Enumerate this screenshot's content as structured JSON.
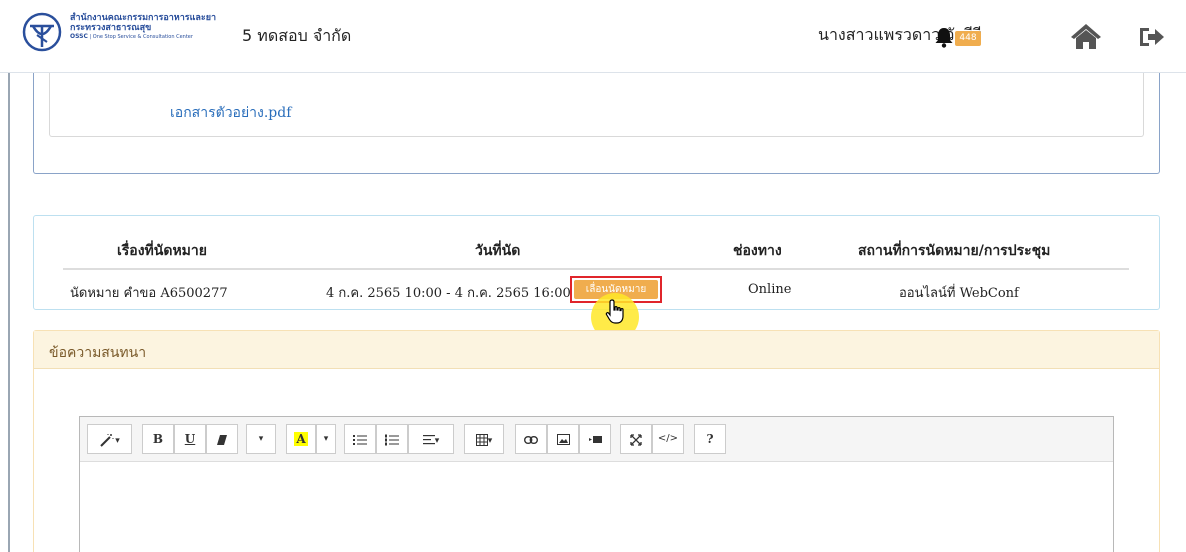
{
  "header": {
    "org_line1": "สำนักงานคณะกรรมการอาหารและยา",
    "org_line2": "กระทรวงสาธารณสุข",
    "org_line3_brand": "OSSC",
    "org_line3_text": "| One Stop Service & Consultation Center",
    "company_name": "5 ทดสอบ จำกัด",
    "user_name": "นางสาวแพรวดาว วังคีรี",
    "notification_count": "448",
    "icons": [
      "fda-logo-icon",
      "bell-icon",
      "home-icon",
      "logout-icon"
    ]
  },
  "attachment": {
    "file_link": "เอกสารตัวอย่าง.pdf"
  },
  "appointment": {
    "columns": [
      "เรื่องที่นัดหมาย",
      "วันที่นัด",
      "ช่องทาง",
      "สถานที่การนัดหมาย/การประชุม"
    ],
    "rows": [
      {
        "topic": "นัดหมาย คำขอ A6500277",
        "date": "4 ก.ค. 2565 10:00 - 4 ก.ค. 2565 16:00",
        "postpone_label": "เลื่อนนัดหมาย",
        "channel": "Online",
        "place": "ออนไลน์ที่ WebConf"
      }
    ]
  },
  "chat": {
    "title": "ข้อความสนทนา"
  },
  "editor_toolbar": {
    "style_label": "▾",
    "bold": "B",
    "underline": "U",
    "font_label": "▾",
    "color_letter": "A",
    "color_caret": "▾",
    "para_caret": "▾",
    "table_caret": "▾",
    "code_label": "</>",
    "help_label": "?"
  },
  "colors": {
    "accent_orange": "#f0ad4e",
    "highlight_border": "#e0252b",
    "link_blue": "#2a6ebb",
    "chat_header_bg": "#fcf4e0"
  }
}
